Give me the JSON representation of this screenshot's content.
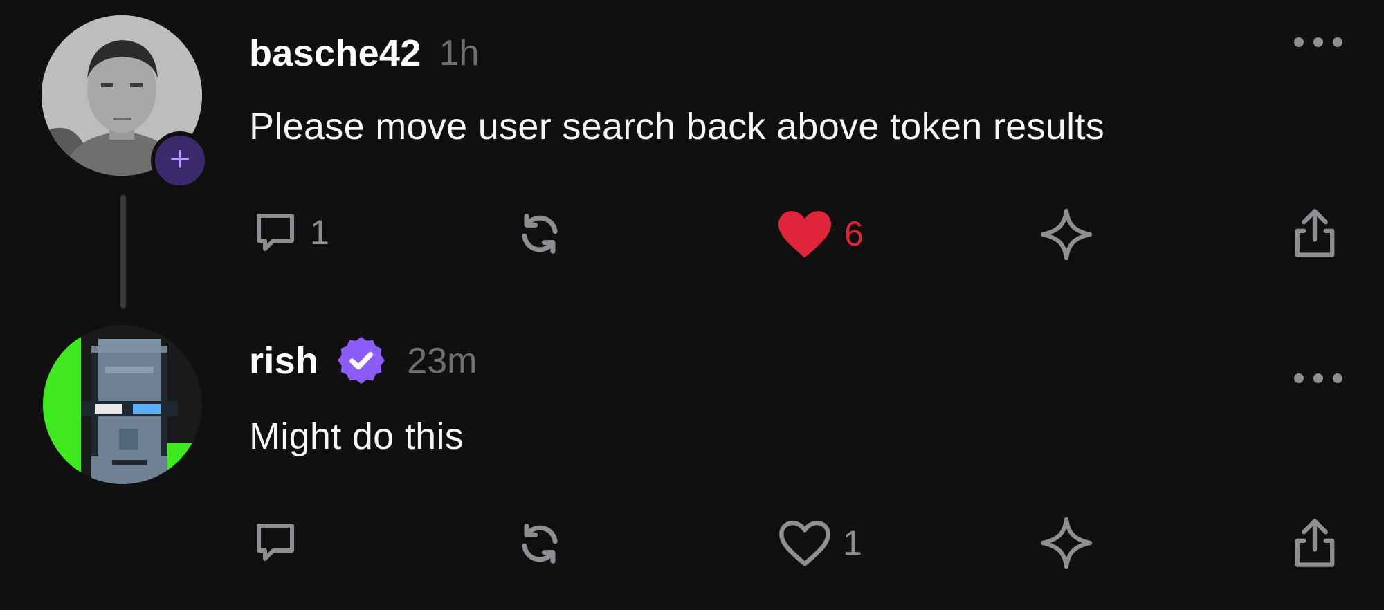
{
  "posts": [
    {
      "username": "basche42",
      "timestamp": "1h",
      "text": "Please move user search back above token results",
      "replies": "1",
      "likes": "6",
      "liked": true
    },
    {
      "username": "rish",
      "verified": true,
      "timestamp": "23m",
      "text": "Might do this",
      "replies": "",
      "likes": "1",
      "liked": false
    }
  ],
  "icons": {
    "reply": "speech-bubble-icon",
    "repost": "repost-arrows-icon",
    "like": "heart-icon",
    "save": "sparkle-star-icon",
    "share": "share-upload-icon",
    "more": "ellipsis-icon",
    "follow": "plus-icon",
    "verified": "verified-badge-icon"
  },
  "colors": {
    "background": "#101011",
    "like_active": "#e0243a",
    "verified": "#8b5cf6",
    "follow_badge": "#3a2a6b",
    "muted": "#8e8e93"
  }
}
